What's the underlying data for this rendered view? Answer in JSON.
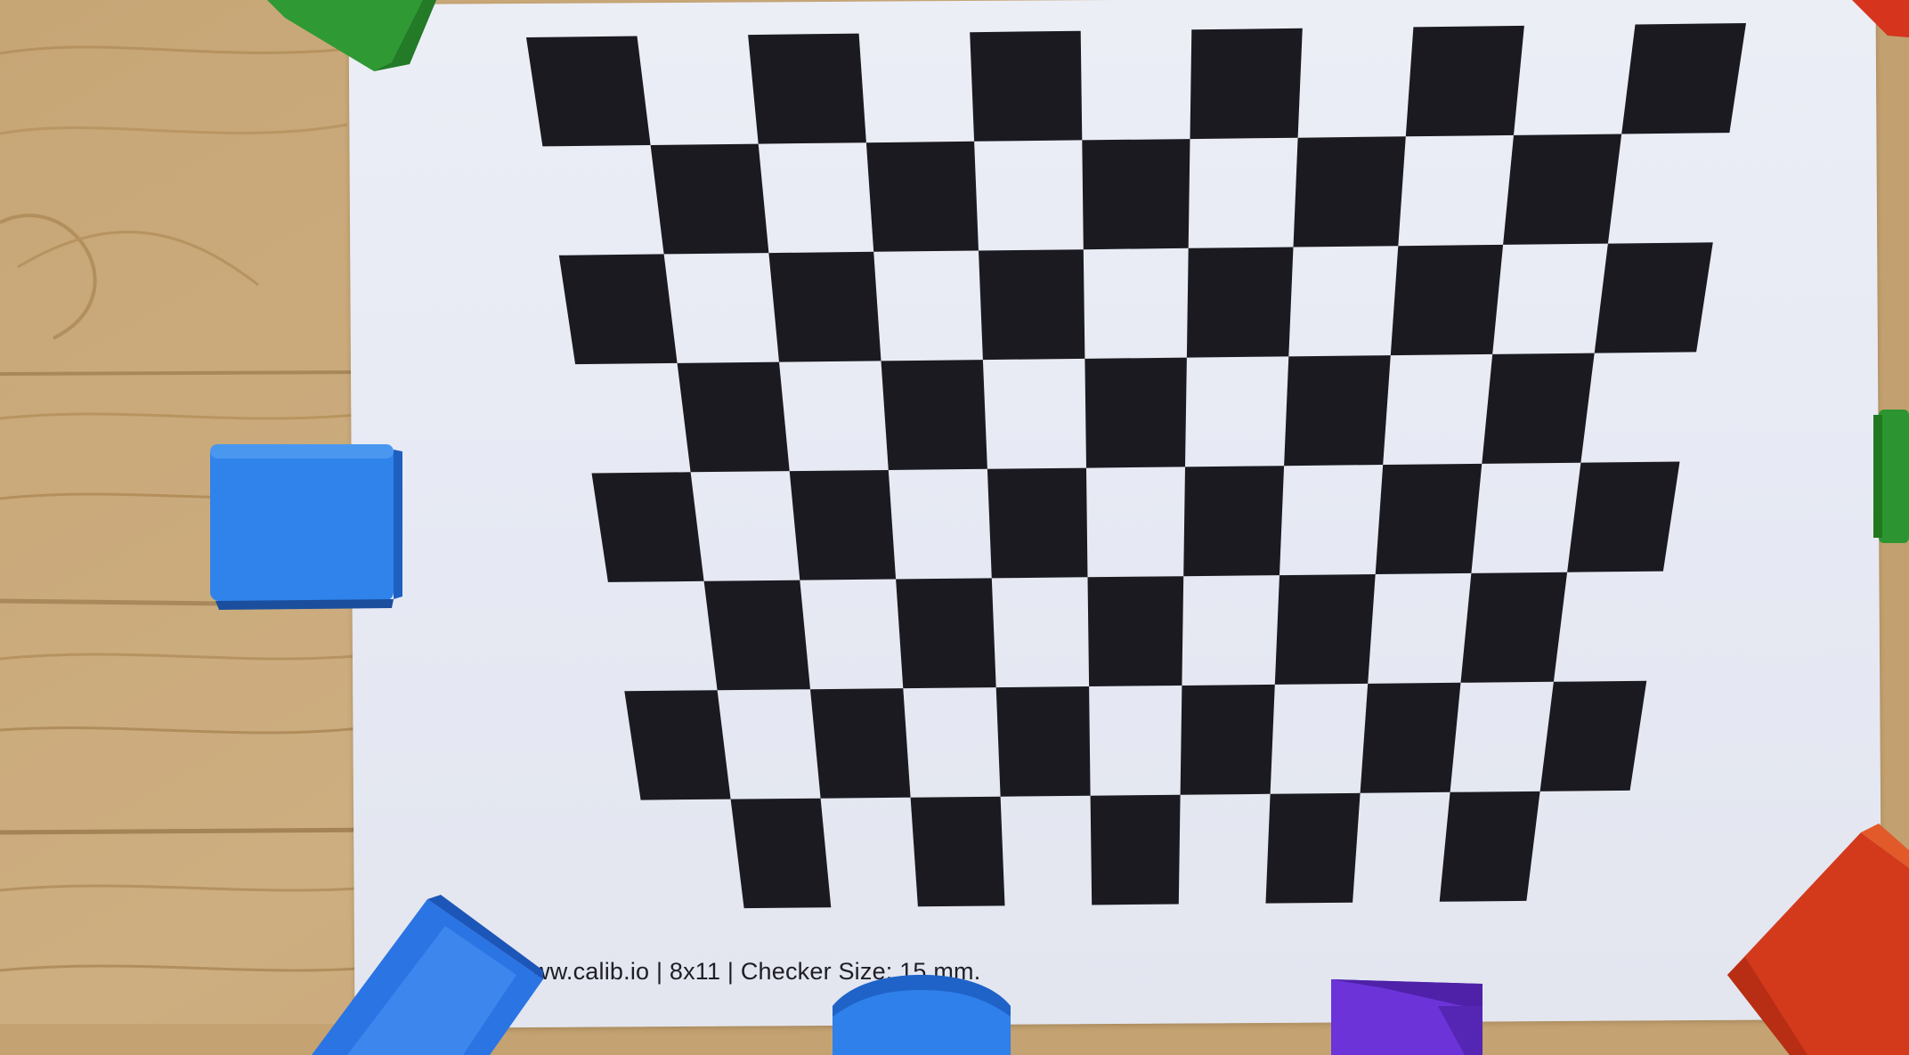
{
  "photo": {
    "caption_text": "ww.calib.io | 8x11 | Checker Size: 15 mm.",
    "checkerboard": {
      "rows": 8,
      "cols": 11,
      "dark_color": "#1b1a20",
      "light_color": "#e9ebf4"
    },
    "colors": {
      "wood": "#c9a979",
      "wood_dark": "#b08d5e",
      "paper": "#e8eaf3",
      "blue_block": "#2f7fe8",
      "green_block": "#2e9a32",
      "red_block": "#d9381e",
      "purple_block": "#6a2fd6"
    }
  }
}
